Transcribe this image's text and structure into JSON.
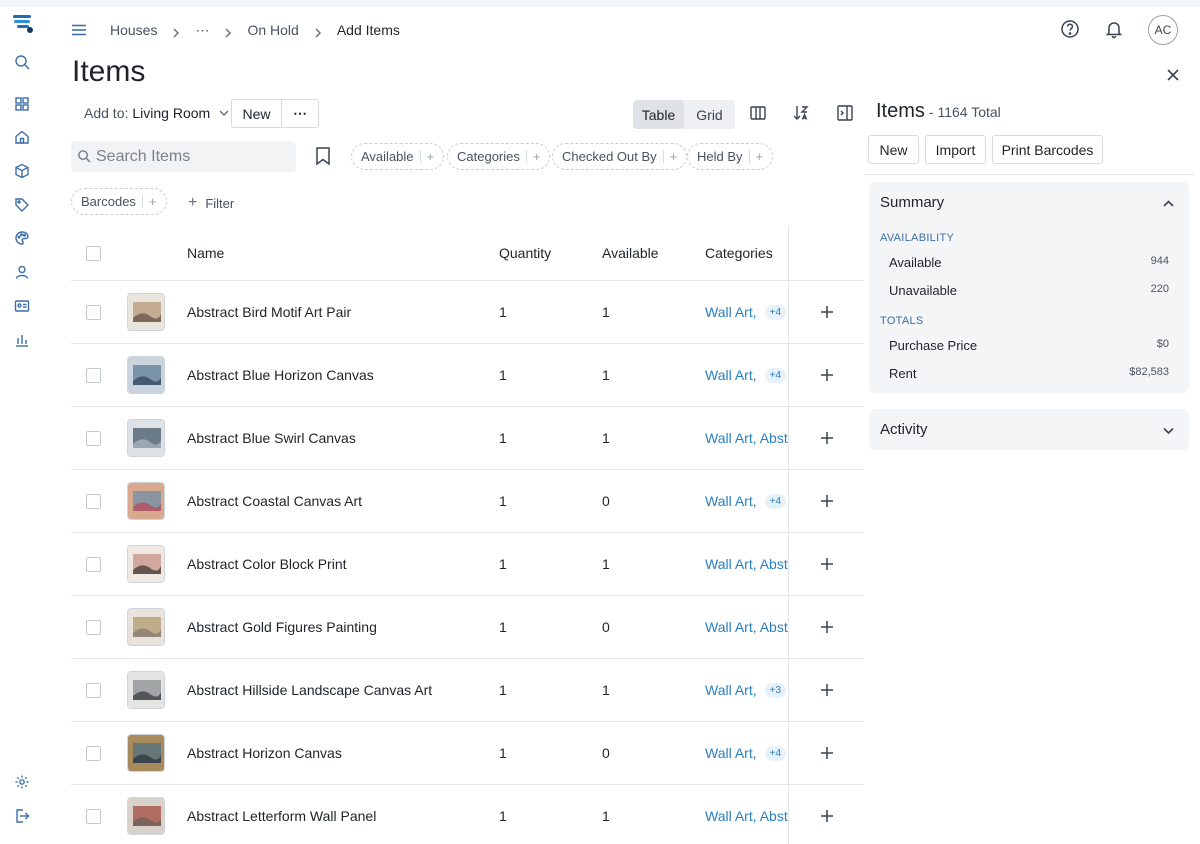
{
  "breadcrumb": {
    "items": [
      "Houses",
      "⋯",
      "On Hold",
      "Add Items"
    ]
  },
  "user": {
    "initials": "AC"
  },
  "page": {
    "title": "Items"
  },
  "toolbar": {
    "add_to_label": "Add to:",
    "add_to_value": "Living Room",
    "new_label": "New",
    "more_label": "⋯",
    "view_table": "Table",
    "view_grid": "Grid",
    "active_view": "Table"
  },
  "search": {
    "placeholder": "Search Items"
  },
  "filters": {
    "chips": [
      "Available",
      "Categories",
      "Checked Out By",
      "Held By",
      "Barcodes"
    ],
    "chip_plus": "+",
    "filter_label": "Filter"
  },
  "table": {
    "columns": {
      "name": "Name",
      "quantity": "Quantity",
      "available": "Available",
      "categories": "Categories"
    },
    "rows": [
      {
        "name": "Abstract Bird Motif Art Pair",
        "quantity": "1",
        "available": "1",
        "categories": "Wall Art,",
        "more": "+4",
        "thumb": [
          "#e9e4dc",
          "#b79a7a",
          "#6b5a4a"
        ]
      },
      {
        "name": "Abstract Blue Horizon Canvas",
        "quantity": "1",
        "available": "1",
        "categories": "Wall Art,",
        "more": "+4",
        "thumb": [
          "#c9d4dc",
          "#5d7d99",
          "#3a4e63"
        ]
      },
      {
        "name": "Abstract Blue Swirl Canvas",
        "quantity": "1",
        "available": "1",
        "categories": "Wall Art, Abstract",
        "more": "",
        "thumb": [
          "#dde2e6",
          "#44576a",
          "#a7b4be"
        ]
      },
      {
        "name": "Abstract Coastal Canvas Art",
        "quantity": "1",
        "available": "0",
        "categories": "Wall Art,",
        "more": "+4",
        "thumb": [
          "#d8a98f",
          "#6f8fa6",
          "#b84d5c"
        ]
      },
      {
        "name": "Abstract Color Block Print",
        "quantity": "1",
        "available": "1",
        "categories": "Wall Art, Abstract",
        "more": "",
        "thumb": [
          "#efe9e3",
          "#c7928a",
          "#4a4038"
        ]
      },
      {
        "name": "Abstract Gold Figures Painting",
        "quantity": "1",
        "available": "0",
        "categories": "Wall Art, Abstract",
        "more": "",
        "thumb": [
          "#e8e3dc",
          "#b49a6e",
          "#8a7e74"
        ]
      },
      {
        "name": "Abstract Hillside Landscape Canvas Art",
        "quantity": "1",
        "available": "1",
        "categories": "Wall Art,",
        "more": "+3",
        "thumb": [
          "#e4e4e2",
          "#8d8f91",
          "#3f4245"
        ]
      },
      {
        "name": "Abstract Horizon Canvas",
        "quantity": "1",
        "available": "0",
        "categories": "Wall Art,",
        "more": "+4",
        "thumb": [
          "#a88a5c",
          "#4f6f7f",
          "#2e3a40"
        ]
      },
      {
        "name": "Abstract Letterform Wall Panel",
        "quantity": "1",
        "available": "1",
        "categories": "Wall Art, Abstract",
        "more": "",
        "thumb": [
          "#d9d2cb",
          "#a04a3e",
          "#6c625b"
        ]
      }
    ]
  },
  "panel": {
    "title": "Items",
    "subtitle": "- 1164 Total",
    "buttons": {
      "new": "New",
      "import": "Import",
      "print_barcodes": "Print Barcodes"
    },
    "summary": {
      "heading": "Summary",
      "availability_label": "AVAILABILITY",
      "available_label": "Available",
      "available_value": "944",
      "unavailable_label": "Unavailable",
      "unavailable_value": "220",
      "totals_label": "TOTALS",
      "purchase_label": "Purchase Price",
      "purchase_value": "$0",
      "rent_label": "Rent",
      "rent_value": "$82,583"
    },
    "activity": {
      "heading": "Activity"
    }
  },
  "colors": {
    "accent": "#2a7fc1",
    "rail_icon": "#3e6fa8",
    "brand": "#1e6fb8"
  }
}
